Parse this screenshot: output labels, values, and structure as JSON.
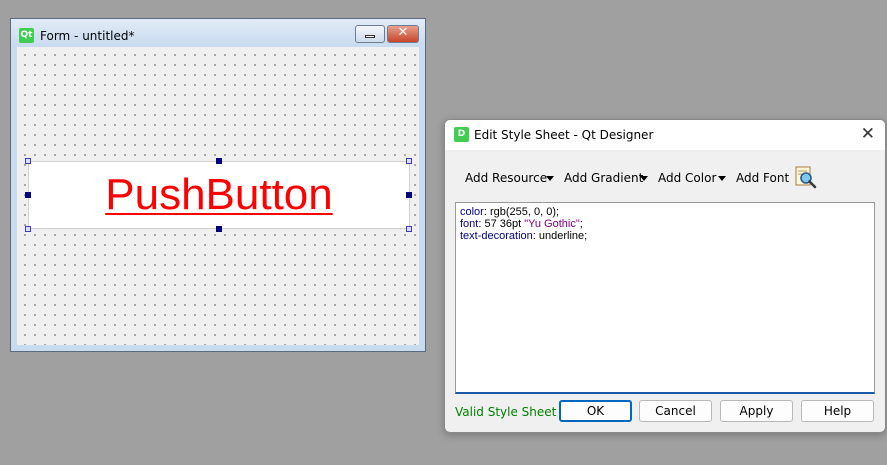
{
  "form_window": {
    "title": "Form - untitled*",
    "logo_text": "Qt",
    "minimize_icon": "minimize-icon",
    "close_icon": "close-icon",
    "push_button": {
      "text": "PushButton",
      "color": "#ff0000"
    }
  },
  "dialog": {
    "title": "Edit Style Sheet - Qt Designer",
    "logo_text": "D",
    "close_glyph": "✕",
    "toolbar": {
      "add_resource": "Add Resource",
      "add_gradient": "Add Gradient",
      "add_color": "Add Color",
      "add_font": "Add Font",
      "find_icon": "magnifier-icon"
    },
    "editor_lines": [
      {
        "prop": "color",
        "value": ": rgb(255, 0, 0);"
      },
      {
        "prop": "font",
        "value_plain": ": 57 36pt ",
        "value_string": "\"Yu Gothic\"",
        "value_end": ";"
      },
      {
        "prop": "text-decoration",
        "value": ": underline;"
      }
    ],
    "status": "Valid Style Sheet",
    "buttons": {
      "ok": "OK",
      "cancel": "Cancel",
      "apply": "Apply",
      "help": "Help"
    }
  }
}
